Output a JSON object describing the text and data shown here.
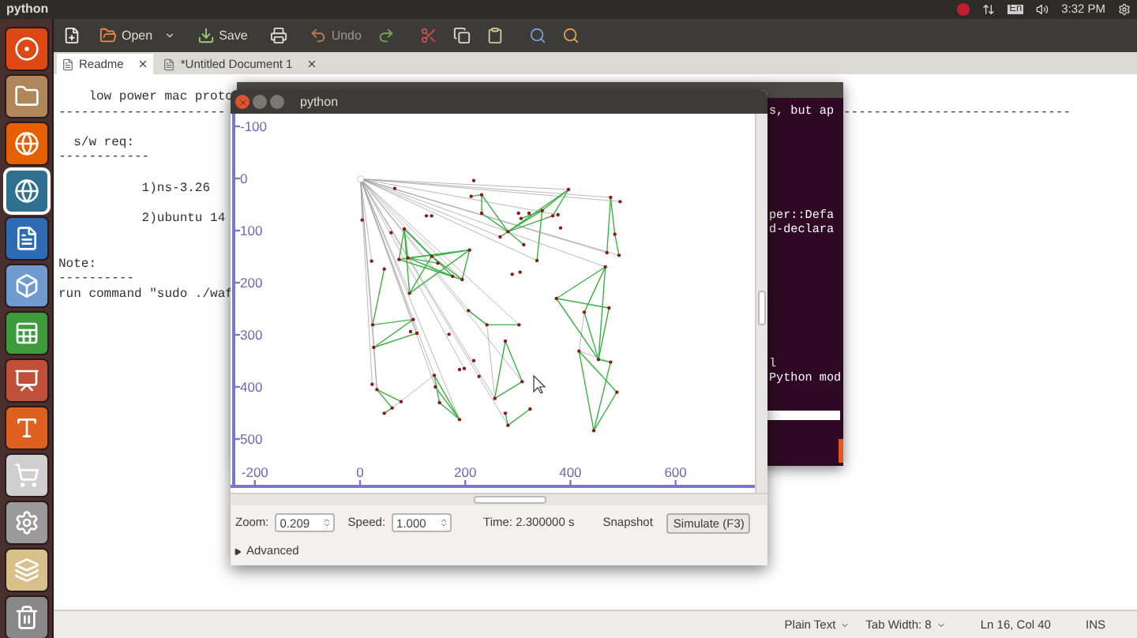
{
  "top_bar": {
    "title": "python",
    "keyboard_layout": "En",
    "clock": "3:32 PM"
  },
  "launcher": [
    {
      "selected": false
    },
    {
      "selected": false
    },
    {
      "selected": false
    },
    {
      "selected": true
    },
    {
      "selected": false
    },
    {
      "selected": false
    },
    {
      "selected": false
    },
    {
      "selected": false
    },
    {
      "selected": false
    },
    {
      "selected": false
    },
    {
      "selected": false
    },
    {
      "selected": false
    },
    {
      "selected": false
    }
  ],
  "toolbar": {
    "open": "Open",
    "save": "Save",
    "undo": "Undo"
  },
  "tabs": [
    {
      "label": "Readme",
      "selected": true
    },
    {
      "label": "*Untitled Document 1",
      "selected": false
    }
  ],
  "editor_lines": [
    {
      "kind": "text",
      "text": "    low power mac proto"
    },
    {
      "kind": "text",
      "text": "----------------------"
    },
    {
      "kind": "blank"
    },
    {
      "kind": "text",
      "text": "  s/w req:"
    },
    {
      "kind": "text",
      "text": "------------"
    },
    {
      "kind": "blank"
    },
    {
      "kind": "text",
      "text": "           1)ns-3.26"
    },
    {
      "kind": "blank"
    },
    {
      "kind": "text",
      "text": "           2)ubuntu 14"
    },
    {
      "kind": "blank"
    },
    {
      "kind": "blank"
    },
    {
      "kind": "text",
      "text": "Note:"
    },
    {
      "kind": "text",
      "text": "----------"
    },
    {
      "kind": "text",
      "text": "run command \"sudo ./waf"
    }
  ],
  "editor_fragment": "------------------------------",
  "status_bar": {
    "language": "Plain Text",
    "tab_width": "Tab Width: 8",
    "position": "Ln 16, Col 40",
    "mode": "INS"
  },
  "terminal_lines": [
    {
      "kind": "text",
      "text": "s, but ap"
    },
    {
      "kind": "blank"
    },
    {
      "kind": "blank"
    },
    {
      "kind": "blank"
    },
    {
      "kind": "blank"
    },
    {
      "kind": "blank"
    },
    {
      "kind": "blank"
    },
    {
      "kind": "text",
      "text": "per::Defa"
    },
    {
      "kind": "text",
      "text": "d-declara"
    },
    {
      "kind": "blank"
    },
    {
      "kind": "blank"
    },
    {
      "kind": "blank"
    },
    {
      "kind": "blank"
    },
    {
      "kind": "blank"
    },
    {
      "kind": "blank"
    },
    {
      "kind": "blank"
    },
    {
      "kind": "blank"
    },
    {
      "kind": "text",
      "text": "l"
    },
    {
      "kind": "text",
      "text": "Python mod"
    }
  ],
  "simulator": {
    "title": "python",
    "y_axis_labels": [
      "-100",
      "0",
      "100",
      "200",
      "300",
      "400",
      "500"
    ],
    "x_axis_labels": [
      "-200",
      "0",
      "200",
      "400",
      "600"
    ],
    "zoom_label": "Zoom:",
    "zoom": "0.209",
    "speed_label": "Speed:",
    "speed": "1.000",
    "time": "Time: 2.300000 s",
    "snapshot": "Snapshot",
    "simulate": "Simulate (F3)",
    "advanced": {
      "label": "Advanced",
      "expanded": false
    }
  }
}
